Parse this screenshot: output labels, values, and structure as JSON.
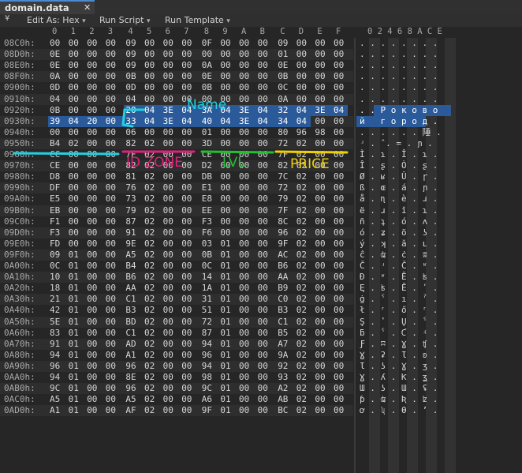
{
  "tab": {
    "title": "domain.data",
    "close": "✕"
  },
  "toolbar": {
    "edit_as": "Edit As: Hex",
    "run_script": "Run Script",
    "run_template": "Run Template",
    "dropdown_glyph": "▾",
    "handle_glyph": "¥"
  },
  "hex_header": [
    "0",
    "1",
    "2",
    "3",
    "4",
    "5",
    "6",
    "7",
    "8",
    "9",
    "A",
    "B",
    "C",
    "D",
    "E",
    "F"
  ],
  "ascii_header": "0 2 4 6 8 A C E",
  "annotations": {
    "name": "Name",
    "id_zone": "ID ZONE",
    "lvl": "LVL",
    "price": "PRICE",
    "colors": {
      "name": "#22d0e0",
      "id_zone": "#e0207a",
      "lvl": "#20c030",
      "price": "#f0d000"
    }
  },
  "colors": {
    "selection": "#2b5a9a",
    "background": "#262626"
  },
  "rows": [
    {
      "addr": "08C0h:",
      "hex": [
        "00",
        "00",
        "00",
        "00",
        "09",
        "00",
        "00",
        "00",
        "0F",
        "00",
        "00",
        "00",
        "09",
        "00",
        "00",
        "00"
      ],
      "ascii": ". . . . . . . ."
    },
    {
      "addr": "08D0h:",
      "hex": [
        "0E",
        "00",
        "00",
        "00",
        "09",
        "00",
        "00",
        "00",
        "00",
        "00",
        "00",
        "00",
        "01",
        "00",
        "00",
        "00"
      ],
      "ascii": ". . . . . . . ."
    },
    {
      "addr": "08E0h:",
      "hex": [
        "0E",
        "00",
        "00",
        "00",
        "09",
        "00",
        "00",
        "00",
        "0A",
        "00",
        "00",
        "00",
        "0E",
        "00",
        "00",
        "00"
      ],
      "ascii": ". . . . . . . ."
    },
    {
      "addr": "08F0h:",
      "hex": [
        "0A",
        "00",
        "00",
        "00",
        "0B",
        "00",
        "00",
        "00",
        "0E",
        "00",
        "00",
        "00",
        "0B",
        "00",
        "00",
        "00"
      ],
      "ascii": ". . . . . . . ."
    },
    {
      "addr": "0900h:",
      "hex": [
        "0D",
        "00",
        "00",
        "00",
        "0D",
        "00",
        "00",
        "00",
        "0B",
        "00",
        "00",
        "00",
        "0C",
        "00",
        "00",
        "00"
      ],
      "ascii": ". . . . . . . ."
    },
    {
      "addr": "0910h:",
      "hex": [
        "04",
        "00",
        "00",
        "00",
        "04",
        "00",
        "00",
        "00",
        "00",
        "00",
        "00",
        "00",
        "0A",
        "00",
        "00",
        "00"
      ],
      "ascii": ". . . . . . . ."
    },
    {
      "addr": "0920h:",
      "hex": [
        "0B",
        "00",
        "00",
        "00",
        "20",
        "04",
        "3E",
        "04",
        "3A",
        "04",
        "3E",
        "04",
        "32",
        "04",
        "3E",
        "04"
      ],
      "ascii": ". . Р о к о в о"
    },
    {
      "addr": "0930h:",
      "hex": [
        "39",
        "04",
        "20",
        "00",
        "33",
        "04",
        "3E",
        "04",
        "40",
        "04",
        "3E",
        "04",
        "34",
        "04",
        "00",
        "00"
      ],
      "ascii": "й   г о р о д ."
    },
    {
      "addr": "0940h:",
      "hex": [
        "00",
        "00",
        "00",
        "00",
        "06",
        "00",
        "00",
        "00",
        "01",
        "00",
        "00",
        "00",
        "80",
        "96",
        "98",
        "00"
      ],
      "ascii": ". . . . . . 陲 ."
    },
    {
      "addr": "0950h:",
      "hex": [
        "B4",
        "02",
        "00",
        "00",
        "82",
        "02",
        "00",
        "00",
        "3D",
        "00",
        "00",
        "00",
        "72",
        "02",
        "00",
        "00"
      ],
      "ascii": "ʴ . ̂ . = . ɲ ."
    },
    {
      "addr": "0960h:",
      "hex": [
        "CC",
        "00",
        "00",
        "00",
        "7F",
        "02",
        "00",
        "00",
        "CE",
        "00",
        "00",
        "00",
        "7F",
        "02",
        "00",
        "00"
      ],
      "ascii": "Ì . ɿ . Î . ɿ ."
    },
    {
      "addr": "0970h:",
      "hex": [
        "CE",
        "00",
        "00",
        "00",
        "82",
        "02",
        "00",
        "00",
        "D2",
        "00",
        "00",
        "00",
        "82",
        "02",
        "00",
        "00"
      ],
      "ascii": "Î . ʂ . Ò . ʂ ."
    },
    {
      "addr": "0980h:",
      "hex": [
        "D8",
        "00",
        "00",
        "00",
        "81",
        "02",
        "00",
        "00",
        "DB",
        "00",
        "00",
        "00",
        "7C",
        "02",
        "00",
        "00"
      ],
      "ascii": "Ø . ʁ . Û . ɼ ."
    },
    {
      "addr": "0990h:",
      "hex": [
        "DF",
        "00",
        "00",
        "00",
        "76",
        "02",
        "00",
        "00",
        "E1",
        "00",
        "00",
        "00",
        "72",
        "02",
        "00",
        "00"
      ],
      "ascii": "ß . ɶ . á . ɲ ."
    },
    {
      "addr": "09A0h:",
      "hex": [
        "E5",
        "00",
        "00",
        "00",
        "73",
        "02",
        "00",
        "00",
        "E8",
        "00",
        "00",
        "00",
        "79",
        "02",
        "00",
        "00"
      ],
      "ascii": "å . ɳ . è . ɹ ."
    },
    {
      "addr": "09B0h:",
      "hex": [
        "EB",
        "00",
        "00",
        "00",
        "79",
        "02",
        "00",
        "00",
        "EE",
        "00",
        "00",
        "00",
        "7F",
        "02",
        "00",
        "00"
      ],
      "ascii": "ë . ɹ . î . ɿ ."
    },
    {
      "addr": "09C0h:",
      "hex": [
        "F1",
        "00",
        "00",
        "00",
        "87",
        "02",
        "00",
        "00",
        "F3",
        "00",
        "00",
        "00",
        "8C",
        "02",
        "00",
        "00"
      ],
      "ascii": "ñ . ʇ . ó . ʌ ."
    },
    {
      "addr": "09D0h:",
      "hex": [
        "F3",
        "00",
        "00",
        "00",
        "91",
        "02",
        "00",
        "00",
        "F6",
        "00",
        "00",
        "00",
        "96",
        "02",
        "00",
        "00"
      ],
      "ascii": "ó . ʑ . ö . ʖ ."
    },
    {
      "addr": "09E0h:",
      "hex": [
        "FD",
        "00",
        "00",
        "00",
        "9E",
        "02",
        "00",
        "00",
        "03",
        "01",
        "00",
        "00",
        "9F",
        "02",
        "00",
        "00"
      ],
      "ascii": "ý . ʞ . ă . ʟ ."
    },
    {
      "addr": "09F0h:",
      "hex": [
        "09",
        "01",
        "00",
        "00",
        "A5",
        "02",
        "00",
        "00",
        "0B",
        "01",
        "00",
        "00",
        "AC",
        "02",
        "00",
        "00"
      ],
      "ascii": "ĉ . ʥ . ċ . ʬ ."
    },
    {
      "addr": "0A00h:",
      "hex": [
        "0C",
        "01",
        "00",
        "00",
        "B4",
        "02",
        "00",
        "00",
        "0C",
        "01",
        "00",
        "00",
        "B6",
        "02",
        "00",
        "00"
      ],
      "ascii": "Č . ʴ . Č . ʶ ."
    },
    {
      "addr": "0A10h:",
      "hex": [
        "10",
        "01",
        "00",
        "00",
        "B6",
        "02",
        "00",
        "00",
        "14",
        "01",
        "00",
        "00",
        "AA",
        "02",
        "00",
        "00"
      ],
      "ascii": "Đ . ʶ . Ĕ . ʪ ."
    },
    {
      "addr": "0A20h:",
      "hex": [
        "18",
        "01",
        "00",
        "00",
        "AA",
        "02",
        "00",
        "00",
        "1A",
        "01",
        "00",
        "00",
        "B9",
        "02",
        "00",
        "00"
      ],
      "ascii": "Ę . ʪ . Ě . ʹ ."
    },
    {
      "addr": "0A30h:",
      "hex": [
        "21",
        "01",
        "00",
        "00",
        "C1",
        "02",
        "00",
        "00",
        "31",
        "01",
        "00",
        "00",
        "C0",
        "02",
        "00",
        "00"
      ],
      "ascii": "ġ . ˁ . ı . ˀ ."
    },
    {
      "addr": "0A40h:",
      "hex": [
        "42",
        "01",
        "00",
        "00",
        "B3",
        "02",
        "00",
        "00",
        "51",
        "01",
        "00",
        "00",
        "B3",
        "02",
        "00",
        "00"
      ],
      "ascii": "ł . ʳ . ő . ʳ ."
    },
    {
      "addr": "0A50h:",
      "hex": [
        "5E",
        "01",
        "00",
        "00",
        "BD",
        "02",
        "00",
        "00",
        "72",
        "01",
        "00",
        "00",
        "C1",
        "02",
        "00",
        "00"
      ],
      "ascii": "Ş . ʽ . Ų . ˁ ."
    },
    {
      "addr": "0A60h:",
      "hex": [
        "83",
        "01",
        "00",
        "00",
        "C1",
        "02",
        "00",
        "00",
        "87",
        "01",
        "00",
        "00",
        "B5",
        "02",
        "00",
        "00"
      ],
      "ascii": "ƃ . ˁ . Ƈ . ʵ ."
    },
    {
      "addr": "0A70h:",
      "hex": [
        "91",
        "01",
        "00",
        "00",
        "AD",
        "02",
        "00",
        "00",
        "94",
        "01",
        "00",
        "00",
        "A7",
        "02",
        "00",
        "00"
      ],
      "ascii": "Ƒ . ʭ . Ɣ . ʧ ."
    },
    {
      "addr": "0A80h:",
      "hex": [
        "94",
        "01",
        "00",
        "00",
        "A1",
        "02",
        "00",
        "00",
        "96",
        "01",
        "00",
        "00",
        "9A",
        "02",
        "00",
        "00"
      ],
      "ascii": "Ɣ . ʡ . Ɩ . ʚ ."
    },
    {
      "addr": "0A90h:",
      "hex": [
        "96",
        "01",
        "00",
        "00",
        "96",
        "02",
        "00",
        "00",
        "94",
        "01",
        "00",
        "00",
        "92",
        "02",
        "00",
        "00"
      ],
      "ascii": "Ɩ . ʖ . Ɣ . ʒ ."
    },
    {
      "addr": "0AA0h:",
      "hex": [
        "94",
        "01",
        "00",
        "00",
        "8E",
        "02",
        "00",
        "00",
        "98",
        "01",
        "00",
        "00",
        "93",
        "02",
        "00",
        "00"
      ],
      "ascii": "Ɣ . ʎ . Ƙ . ʓ ."
    },
    {
      "addr": "0AB0h:",
      "hex": [
        "9C",
        "01",
        "00",
        "00",
        "96",
        "02",
        "00",
        "00",
        "9C",
        "01",
        "00",
        "00",
        "A2",
        "02",
        "00",
        "00"
      ],
      "ascii": "Ɯ . ʖ . Ɯ . ʢ ."
    },
    {
      "addr": "0AC0h:",
      "hex": [
        "A5",
        "01",
        "00",
        "00",
        "A5",
        "02",
        "00",
        "00",
        "A6",
        "01",
        "00",
        "00",
        "AB",
        "02",
        "00",
        "00"
      ],
      "ascii": "ƥ . ʥ . Ʀ . ʫ ."
    },
    {
      "addr": "0AD0h:",
      "hex": [
        "A1",
        "01",
        "00",
        "00",
        "AF",
        "02",
        "00",
        "00",
        "9F",
        "01",
        "00",
        "00",
        "BC",
        "02",
        "00",
        "00"
      ],
      "ascii": "ơ . ʯ . Ɵ . ʼ ."
    }
  ]
}
